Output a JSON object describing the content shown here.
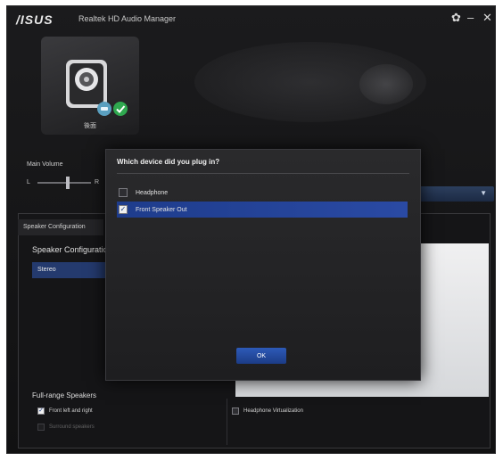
{
  "window": {
    "logo": "/ISUS",
    "title": "Realtek HD Audio Manager",
    "controls": {
      "settings": "✿",
      "minimize": "–",
      "close": "✕"
    }
  },
  "device": {
    "label": "後面"
  },
  "volume": {
    "label": "Main Volume",
    "left": "L",
    "right": "R"
  },
  "speaker_config": {
    "tab": "Speaker Configuration",
    "label": "Speaker Configuration",
    "selected": "Stereo"
  },
  "full_range": {
    "title": "Full-range Speakers",
    "front_lr": {
      "label": "Front left and right",
      "checked": true
    },
    "surround": {
      "label": "Surround speakers",
      "checked": false,
      "disabled": true
    }
  },
  "headphone_virtualization": {
    "label": "Headphone Virtualization",
    "checked": false
  },
  "dialog": {
    "question": "Which device did you plug in?",
    "options": [
      {
        "label": "Headphone",
        "checked": false
      },
      {
        "label": "Front Speaker Out",
        "checked": true
      }
    ],
    "ok": "OK"
  },
  "colors": {
    "accent": "#2d5ab8",
    "selection": "#1e3c8c",
    "status_ok": "#2fa84f"
  }
}
